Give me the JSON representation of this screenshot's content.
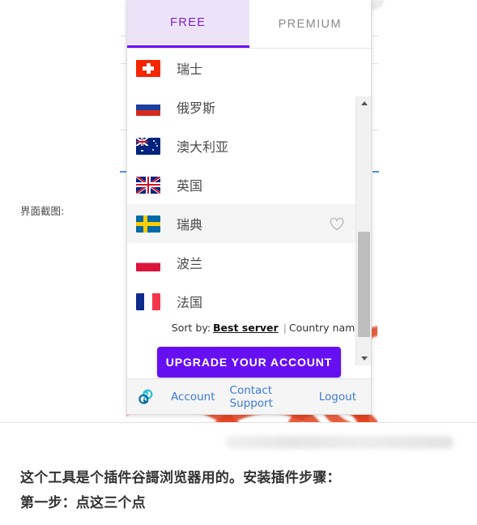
{
  "page": {
    "left_label": "界面截图:",
    "body_lines": [
      "这个工具是个插件谷謌浏览器用的。安装插件步骤：",
      "第一步：点这三个点"
    ]
  },
  "popup": {
    "tabs": [
      {
        "label": "FREE",
        "active": true
      },
      {
        "label": "PREMIUM",
        "active": false
      }
    ],
    "countries": [
      {
        "name": "瑞士",
        "flag": "switzerland-flag",
        "hovered": false,
        "favorite_icon": ""
      },
      {
        "name": "俄罗斯",
        "flag": "russia-flag",
        "hovered": false,
        "favorite_icon": ""
      },
      {
        "name": "澳大利亚",
        "flag": "australia-flag",
        "hovered": false,
        "favorite_icon": ""
      },
      {
        "name": "英国",
        "flag": "unitedkingdom-flag",
        "hovered": false,
        "favorite_icon": ""
      },
      {
        "name": "瑞典",
        "flag": "sweden-flag",
        "hovered": true,
        "favorite_icon": "heart-outline-icon"
      },
      {
        "name": "波兰",
        "flag": "poland-flag",
        "hovered": false,
        "favorite_icon": ""
      },
      {
        "name": "法国",
        "flag": "france-flag",
        "hovered": false,
        "favorite_icon": ""
      }
    ],
    "sort": {
      "label": "Sort by:",
      "option_best": "Best server",
      "separator": "|",
      "option_country": "Country name"
    },
    "upgrade_label": "UPGRADE YOUR ACCOUNT",
    "footer": {
      "logo": "brand-logo-icon",
      "links": [
        "Account",
        "Contact Support",
        "Logout"
      ]
    },
    "scrollbar": {
      "up_arrow": "scroll-up-arrow-icon",
      "down_arrow": "scroll-down-arrow-icon"
    }
  },
  "colors": {
    "accent_purple": "#6610f2",
    "tab_active_bg": "#ede3f8",
    "tab_active_text": "#7a1ed6",
    "link_blue": "#3a7bd5",
    "row_hover": "#f5f5f5",
    "footer_bg": "#f5f5f5"
  }
}
